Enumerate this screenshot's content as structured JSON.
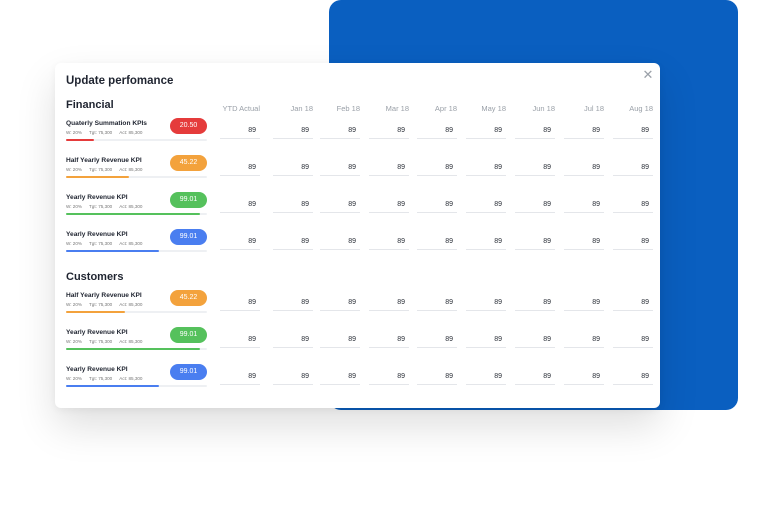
{
  "modal": {
    "title": "Update perfomance",
    "close_icon": "close-icon",
    "columns": [
      "YTD Actual",
      "Jan 18",
      "Feb 18",
      "Mar 18",
      "Apr 18",
      "May 18",
      "Jun 18",
      "Jul 18",
      "Aug 18"
    ]
  },
  "colors": {
    "brand_blue": "#0a5fc0",
    "red": "#e53b3b",
    "orange": "#f3a23c",
    "green": "#55c15c",
    "blue": "#4a7ef0"
  },
  "sections": [
    {
      "title": "Financial",
      "kpis": [
        {
          "name": "Quaterly Summation KPIs",
          "w": "W: 20%",
          "tgt": "Tgt: 75,300",
          "act": "Act: 85,300",
          "score": "20.50",
          "color": "red",
          "progress": 0.2,
          "values": [
            "89",
            "89",
            "89",
            "89",
            "89",
            "89",
            "89",
            "89",
            "89"
          ]
        },
        {
          "name": "Half Yearly Revenue KPI",
          "w": "W: 20%",
          "tgt": "Tgt: 75,300",
          "act": "Act: 85,300",
          "score": "45.22",
          "color": "orange",
          "progress": 0.45,
          "values": [
            "89",
            "89",
            "89",
            "89",
            "89",
            "89",
            "89",
            "89",
            "89"
          ]
        },
        {
          "name": "Yearly Revenue KPI",
          "w": "W: 20%",
          "tgt": "Tgt: 75,300",
          "act": "Act: 85,300",
          "score": "99.01",
          "color": "green",
          "progress": 0.95,
          "values": [
            "89",
            "89",
            "89",
            "89",
            "89",
            "89",
            "89",
            "89",
            "89"
          ]
        },
        {
          "name": "Yearly Revenue KPI",
          "w": "W: 20%",
          "tgt": "Tgt: 75,300",
          "act": "Act: 85,300",
          "score": "99.01",
          "color": "blue",
          "progress": 0.66,
          "values": [
            "89",
            "89",
            "89",
            "89",
            "89",
            "89",
            "89",
            "89",
            "89"
          ]
        }
      ]
    },
    {
      "title": "Customers",
      "kpis": [
        {
          "name": "Half Yearly Revenue KPI",
          "w": "W: 20%",
          "tgt": "Tgt: 75,300",
          "act": "Act: 85,300",
          "score": "45.22",
          "color": "orange",
          "progress": 0.42,
          "values": [
            "89",
            "89",
            "89",
            "89",
            "89",
            "89",
            "89",
            "89",
            "89"
          ]
        },
        {
          "name": "Yearly Revenue KPI",
          "w": "W: 20%",
          "tgt": "Tgt: 75,300",
          "act": "Act: 85,300",
          "score": "99.01",
          "color": "green",
          "progress": 0.95,
          "values": [
            "89",
            "89",
            "89",
            "89",
            "89",
            "89",
            "89",
            "89",
            "89"
          ]
        },
        {
          "name": "Yearly Revenue KPI",
          "w": "W: 20%",
          "tgt": "Tgt: 75,300",
          "act": "Act: 85,300",
          "score": "99.01",
          "color": "blue",
          "progress": 0.66,
          "values": [
            "89",
            "89",
            "89",
            "89",
            "89",
            "89",
            "89",
            "89",
            "89"
          ]
        }
      ]
    }
  ]
}
